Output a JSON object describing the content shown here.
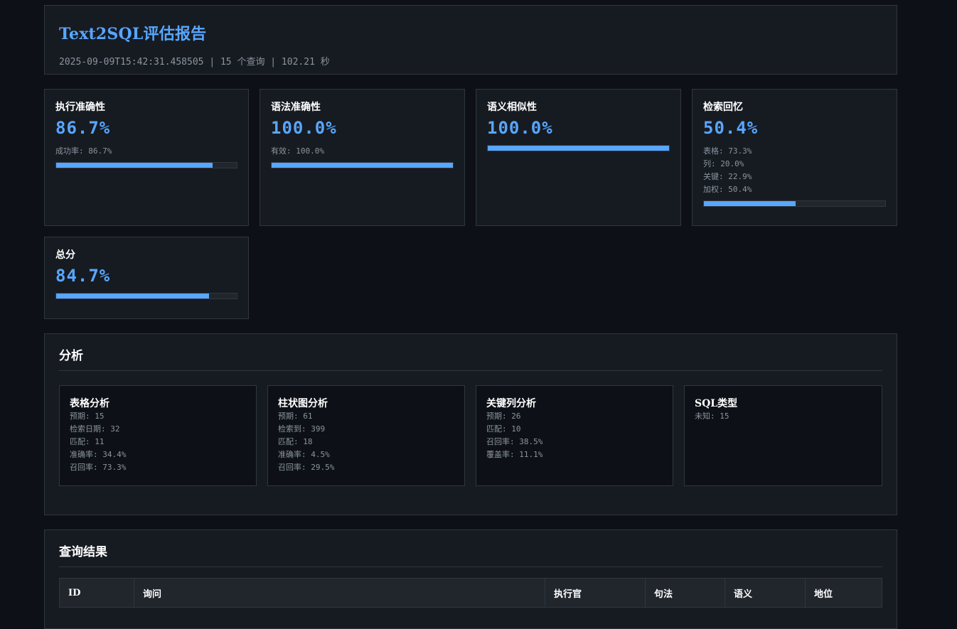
{
  "header": {
    "title": "Text2SQL评估报告",
    "meta": "2025-09-09T15:42:31.458505 | 15 个查询 | 102.21 秒"
  },
  "colors": {
    "accent": "#58a6ff",
    "background": "#0d1117",
    "panel": "#161b22"
  },
  "metrics": [
    {
      "name": "执行准确性",
      "value": "86.7%",
      "details": [
        "成功率: 86.7%"
      ],
      "progress": 0.867
    },
    {
      "name": "语法准确性",
      "value": "100.0%",
      "details": [
        "有效: 100.0%"
      ],
      "progress": 1.0
    },
    {
      "name": "语义相似性",
      "value": "100.0%",
      "details": [],
      "progress": 1.0
    },
    {
      "name": "检索回忆",
      "value": "50.4%",
      "details": [
        "表格: 73.3%",
        "列: 20.0%",
        "关键: 22.9%",
        "加权: 50.4%"
      ],
      "progress": 0.504
    },
    {
      "name": "总分",
      "value": "84.7%",
      "details": [],
      "progress": 0.847
    }
  ],
  "analysis": {
    "title": "分析",
    "cards": [
      {
        "title": "表格分析",
        "lines": [
          "预期: 15",
          "检索日期: 32",
          "匹配: 11",
          "准确率: 34.4%",
          "召回率: 73.3%"
        ]
      },
      {
        "title": "柱状图分析",
        "lines": [
          "预期: 61",
          "检索到: 399",
          "匹配: 18",
          "准确率: 4.5%",
          "召回率: 29.5%"
        ]
      },
      {
        "title": "关键列分析",
        "lines": [
          "预期: 26",
          "匹配: 10",
          "召回率: 38.5%",
          "覆盖率: 11.1%"
        ]
      },
      {
        "title": "SQL类型",
        "lines": [
          "未知: 15"
        ]
      }
    ]
  },
  "results": {
    "title": "查询结果",
    "columns": [
      "ID",
      "询问",
      "执行官",
      "句法",
      "语义",
      "地位"
    ]
  }
}
